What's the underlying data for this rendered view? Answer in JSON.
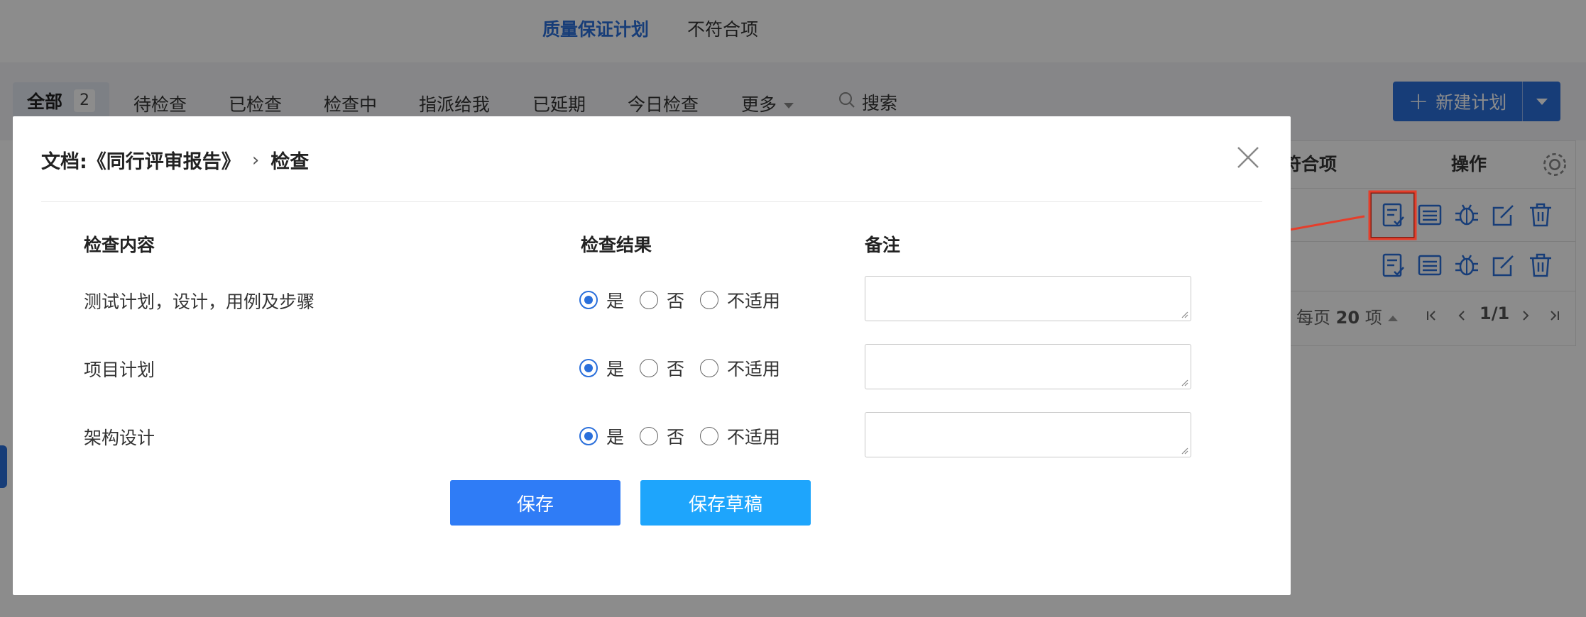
{
  "top_nav": {
    "tabs": [
      "质量保证计划",
      "不符合项"
    ]
  },
  "filter_bar": {
    "all_label": "全部",
    "all_count": "2",
    "items": [
      "待检查",
      "已检查",
      "检查中",
      "指派给我",
      "已延期",
      "今日检查",
      "更多"
    ],
    "search_label": "搜索",
    "new_plan_label": "新建计划"
  },
  "table": {
    "headers": {
      "nonconformity": "符合项",
      "actions": "操作"
    },
    "row_icons": [
      "check-doc-icon",
      "list-icon",
      "bug-icon",
      "edit-icon",
      "trash-icon"
    ],
    "pager": {
      "per_page_prefix": "每页",
      "per_page_value": "20",
      "per_page_suffix": "项",
      "page": "1/1"
    }
  },
  "modal": {
    "title_doc": "文档:《同行评审报告》",
    "title_sep": "›",
    "title_action": "检查",
    "columns": {
      "content": "检查内容",
      "result": "检查结果",
      "note": "备注"
    },
    "options": [
      "是",
      "否",
      "不适用"
    ],
    "rows": [
      {
        "label": "测试计划，设计，用例及步骤",
        "selected": "是",
        "note": ""
      },
      {
        "label": "项目计划",
        "selected": "是",
        "note": ""
      },
      {
        "label": "架构设计",
        "selected": "是",
        "note": ""
      }
    ],
    "save_label": "保存",
    "draft_label": "保存草稿"
  },
  "colors": {
    "primary": "#2a6fdb",
    "save_button": "#2f7cf6",
    "draft_button": "#1ea5fc",
    "annotation_red": "#e53e2b"
  }
}
